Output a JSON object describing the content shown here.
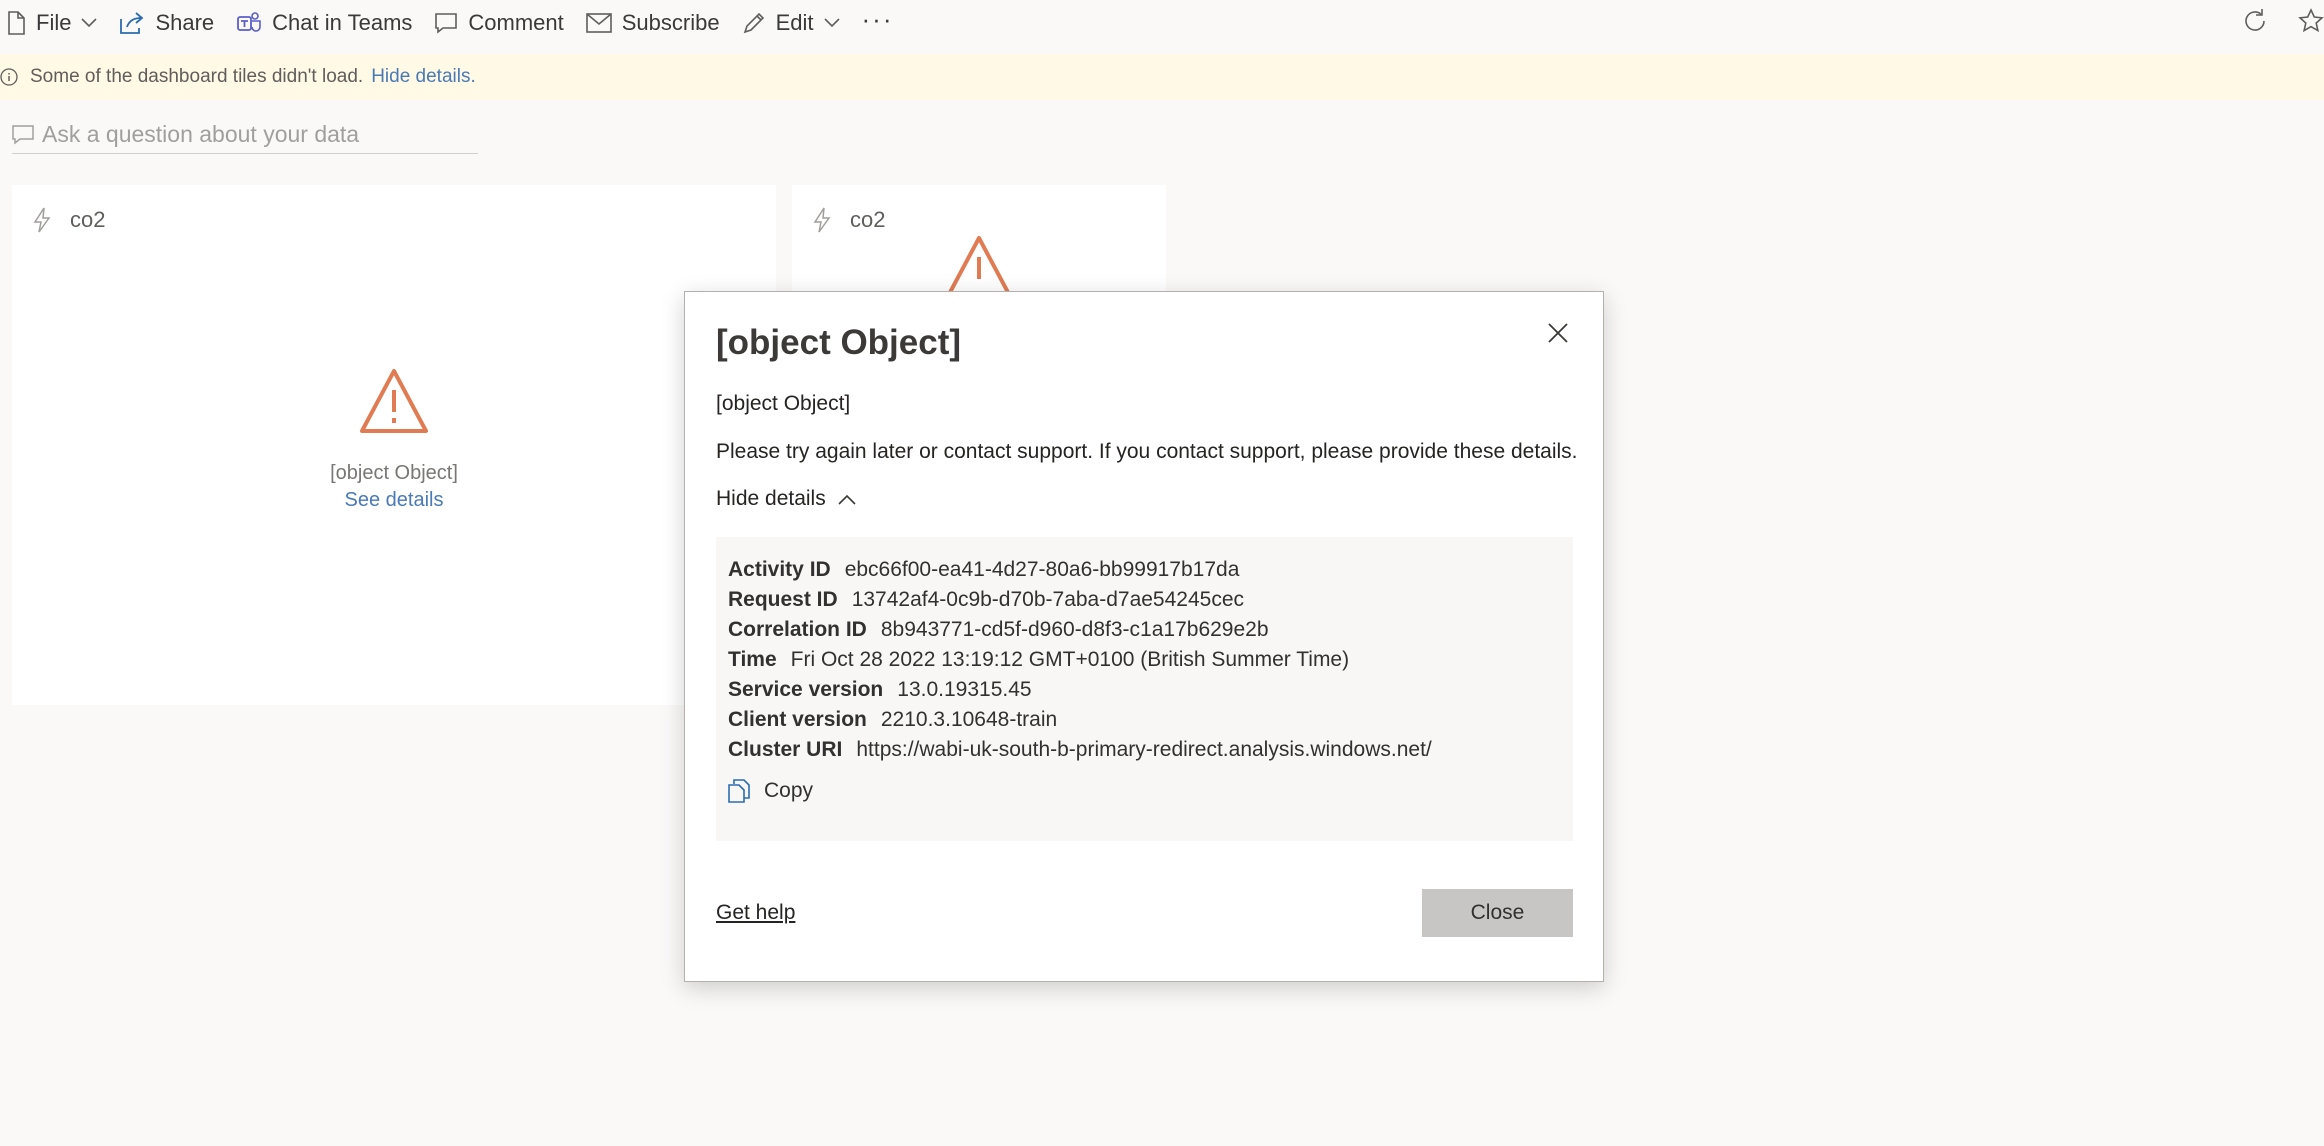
{
  "toolbar": {
    "file": "File",
    "share": "Share",
    "chat": "Chat in Teams",
    "comment": "Comment",
    "subscribe": "Subscribe",
    "edit": "Edit",
    "more": "···"
  },
  "banner": {
    "text": "Some of the dashboard tiles didn't load.",
    "link": "Hide details."
  },
  "qna": {
    "placeholder": "Ask a question about your data"
  },
  "tiles": [
    {
      "title": "co2",
      "message": "[object Object]",
      "link": "See details"
    },
    {
      "title": "co2"
    }
  ],
  "dialog": {
    "title": "[object Object]",
    "subtitle": "[object Object]",
    "message": "Please try again later or contact support. If you contact support, please provide these details.",
    "toggle": "Hide details",
    "details": [
      {
        "key": "Activity ID",
        "value": "ebc66f00-ea41-4d27-80a6-bb99917b17da"
      },
      {
        "key": "Request ID",
        "value": "13742af4-0c9b-d70b-7aba-d7ae54245cec"
      },
      {
        "key": "Correlation ID",
        "value": "8b943771-cd5f-d960-d8f3-c1a17b629e2b"
      },
      {
        "key": "Time",
        "value": "Fri Oct 28 2022 13:19:12 GMT+0100 (British Summer Time)"
      },
      {
        "key": "Service version",
        "value": "13.0.19315.45"
      },
      {
        "key": "Client version",
        "value": "2210.3.10648-train"
      },
      {
        "key": "Cluster URI",
        "value": "https://wabi-uk-south-b-primary-redirect.analysis.windows.net/"
      }
    ],
    "copy": "Copy",
    "get_help": "Get help",
    "close": "Close"
  },
  "colors": {
    "warning": "#e07b53",
    "link": "#4a7ab6",
    "banner_bg": "#fff9e5",
    "teams": "#5b5fc7"
  }
}
